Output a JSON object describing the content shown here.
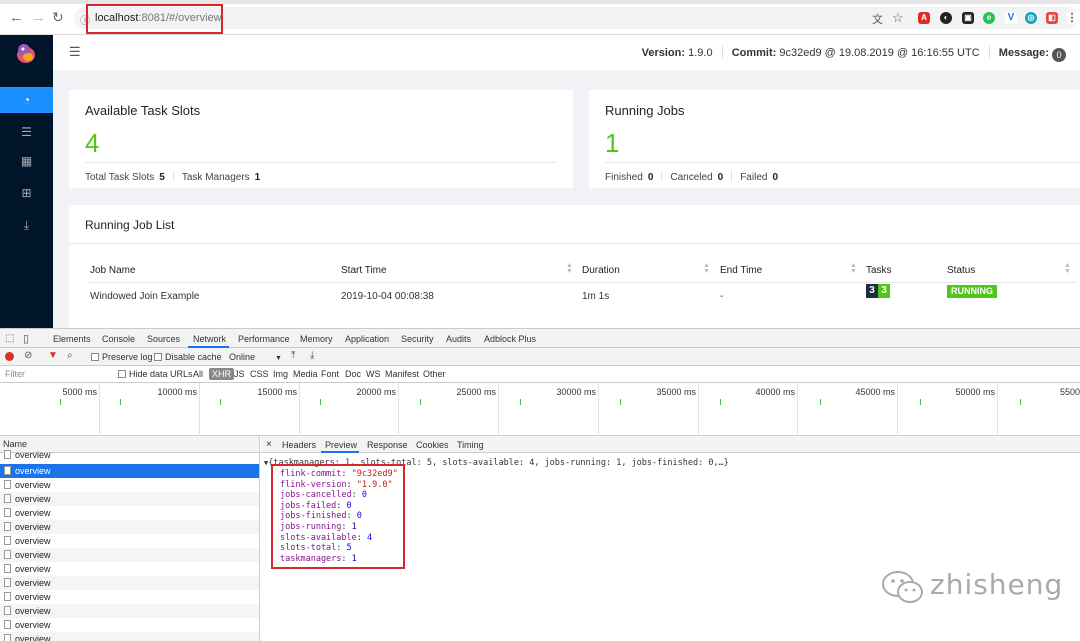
{
  "browser": {
    "url_host": "localhost",
    "url_path": ":8081/#/overview"
  },
  "header": {
    "version_label": "Version:",
    "version": "1.9.0",
    "commit_label": "Commit:",
    "commit": "9c32ed9 @ 19.08.2019 @ 16:16:55 UTC",
    "message_label": "Message:",
    "message_count": "0"
  },
  "sidebar": {
    "items": [
      "overview-icon",
      "list-icon",
      "calendar-icon",
      "cluster-icon",
      "upload-icon"
    ]
  },
  "task_slots": {
    "title": "Available Task Slots",
    "value": "4",
    "total_label": "Total Task Slots",
    "total": "5",
    "tm_label": "Task Managers",
    "tm": "1"
  },
  "running_jobs": {
    "title": "Running Jobs",
    "value": "1",
    "finished_label": "Finished",
    "finished": "0",
    "canceled_label": "Canceled",
    "canceled": "0",
    "failed_label": "Failed",
    "failed": "0"
  },
  "job_list": {
    "title": "Running Job List",
    "columns": [
      "Job Name",
      "Start Time",
      "Duration",
      "End Time",
      "Tasks",
      "Status"
    ],
    "rows": [
      {
        "name": "Windowed Join Example",
        "start": "2019-10-04 00:08:38",
        "duration": "1m 1s",
        "end": "-",
        "tasks_a": "3",
        "tasks_b": "3",
        "status": "RUNNING"
      }
    ],
    "colors": {
      "tasks_a": "#1f2d3d",
      "tasks_b": "#52c41a",
      "status": "#52c41a"
    }
  },
  "devtools": {
    "tabs": [
      "Elements",
      "Console",
      "Sources",
      "Network",
      "Performance",
      "Memory",
      "Application",
      "Security",
      "Audits",
      "Adblock Plus"
    ],
    "toolbar": {
      "preserve_log": "Preserve log",
      "disable_cache": "Disable cache",
      "throttle": "Online"
    },
    "filter": {
      "placeholder": "Filter",
      "hide_data_urls": "Hide data URLs",
      "types": [
        "All",
        "XHR",
        "JS",
        "CSS",
        "Img",
        "Media",
        "Font",
        "Doc",
        "WS",
        "Manifest",
        "Other"
      ]
    },
    "timeline": [
      "5000 ms",
      "10000 ms",
      "15000 ms",
      "20000 ms",
      "25000 ms",
      "30000 ms",
      "35000 ms",
      "40000 ms",
      "45000 ms",
      "50000 ms",
      "5500"
    ],
    "list_header": "Name",
    "requests": [
      "overview",
      "overview",
      "overview",
      "overview",
      "overview",
      "overview",
      "overview",
      "overview",
      "overview",
      "overview",
      "overview",
      "overview",
      "overview",
      "overview"
    ],
    "detail_tabs": [
      "Headers",
      "Preview",
      "Response",
      "Cookies",
      "Timing"
    ],
    "preview_summary": "{taskmanagers: 1, slots-total: 5, slots-available: 4, jobs-running: 1, jobs-finished: 0,…}",
    "preview_fields": [
      {
        "key": "flink-commit",
        "value": "\"9c32ed9\"",
        "kind": "string"
      },
      {
        "key": "flink-version",
        "value": "\"1.9.0\"",
        "kind": "string"
      },
      {
        "key": "jobs-cancelled",
        "value": "0",
        "kind": "number"
      },
      {
        "key": "jobs-failed",
        "value": "0",
        "kind": "number"
      },
      {
        "key": "jobs-finished",
        "value": "0",
        "kind": "number"
      },
      {
        "key": "jobs-running",
        "value": "1",
        "kind": "number"
      },
      {
        "key": "slots-available",
        "value": "4",
        "kind": "number"
      },
      {
        "key": "slots-total",
        "value": "5",
        "kind": "number"
      },
      {
        "key": "taskmanagers",
        "value": "1",
        "kind": "number"
      }
    ]
  },
  "watermark": "zhisheng"
}
